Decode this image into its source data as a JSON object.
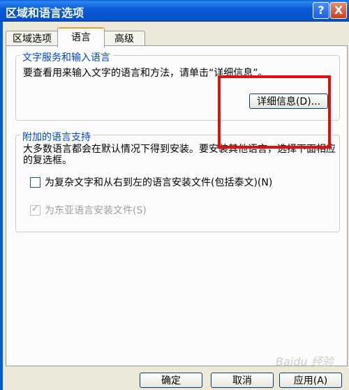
{
  "window": {
    "title": "区域和语言选项",
    "help_label": "?",
    "close_label": "X"
  },
  "tabs": [
    {
      "label": "区域选项"
    },
    {
      "label": "语言"
    },
    {
      "label": "高级"
    }
  ],
  "text_services": {
    "legend": "文字服务和输入语言",
    "description": "要查看用来输入文字的语言和方法，请单击“详细信息”。",
    "details_button": "详细信息(D)..."
  },
  "supplemental": {
    "legend": "附加的语言支持",
    "description": "大多数语言都会在默认情况下得到安装。要安装其他语言，选择下面相应的复选框。",
    "complex_script_checkbox": {
      "label": "为复杂文字和从右到左的语言安装文件(包括泰文)(N)",
      "checked": false
    },
    "east_asian_checkbox": {
      "label": "为东亚语言安装文件(S)",
      "checked": true,
      "disabled": true
    }
  },
  "footer": {
    "ok": "确定",
    "cancel": "取消",
    "apply": "应用(A)"
  },
  "watermark": "Baidu 经验",
  "colors": {
    "titlebar": "#0a5ad6",
    "legend_text": "#0046d5",
    "highlight_box": "#e01010"
  }
}
